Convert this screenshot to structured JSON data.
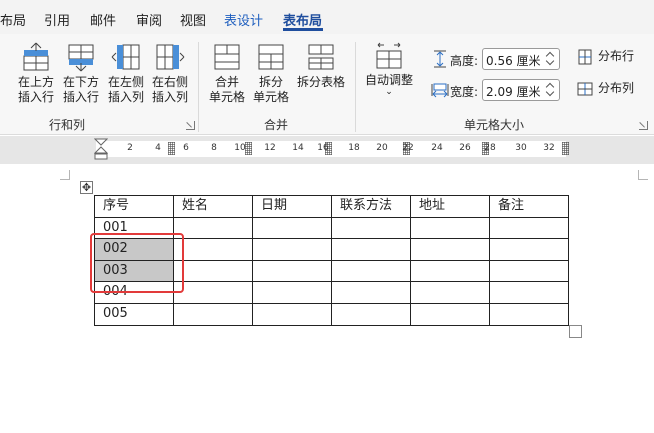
{
  "tabs": [
    {
      "label": "布局",
      "name": "tab-layout"
    },
    {
      "label": "引用",
      "name": "tab-references"
    },
    {
      "label": "邮件",
      "name": "tab-mailings"
    },
    {
      "label": "审阅",
      "name": "tab-review"
    },
    {
      "label": "视图",
      "name": "tab-view"
    },
    {
      "label": "表设计",
      "name": "tab-table-design"
    },
    {
      "label": "表布局",
      "name": "tab-table-layout"
    }
  ],
  "ribbon": {
    "rows_cols": {
      "insert_above": "在上方\n插入行",
      "insert_below": "在下方\n插入行",
      "insert_left": "在左侧\n插入列",
      "insert_right": "在右侧\n插入列",
      "group_label": "行和列"
    },
    "merge": {
      "merge_cells": "合并\n单元格",
      "split_cells": "拆分\n单元格",
      "split_table": "拆分表格",
      "group_label": "合并"
    },
    "cell_size": {
      "autofit": "自动调整",
      "height_label": "高度:",
      "height_value": "0.56 厘米",
      "width_label": "宽度:",
      "width_value": "2.09 厘米",
      "distribute_rows": "分布行",
      "distribute_cols": "分布列",
      "group_label": "单元格大小"
    }
  },
  "ruler": {
    "ticks": [
      "2",
      "4",
      "6",
      "8",
      "10",
      "12",
      "14",
      "16",
      "18",
      "20",
      "22",
      "24",
      "26",
      "28",
      "30",
      "32"
    ]
  },
  "table": {
    "header": [
      "序号",
      "姓名",
      "日期",
      "联系方法",
      "地址",
      "备注"
    ],
    "rows": [
      [
        "001",
        "",
        "",
        "",
        "",
        ""
      ],
      [
        "002",
        "",
        "",
        "",
        "",
        ""
      ],
      [
        "003",
        "",
        "",
        "",
        "",
        ""
      ],
      [
        "004",
        "",
        "",
        "",
        "",
        ""
      ],
      [
        "005",
        "",
        "",
        "",
        "",
        ""
      ]
    ],
    "selected_cells": [
      [
        1,
        0
      ],
      [
        2,
        0
      ]
    ]
  },
  "colors": {
    "active_tab": "#1f4e9e",
    "selection": "#c8c8c8",
    "highlight_box": "#e23a3a"
  }
}
